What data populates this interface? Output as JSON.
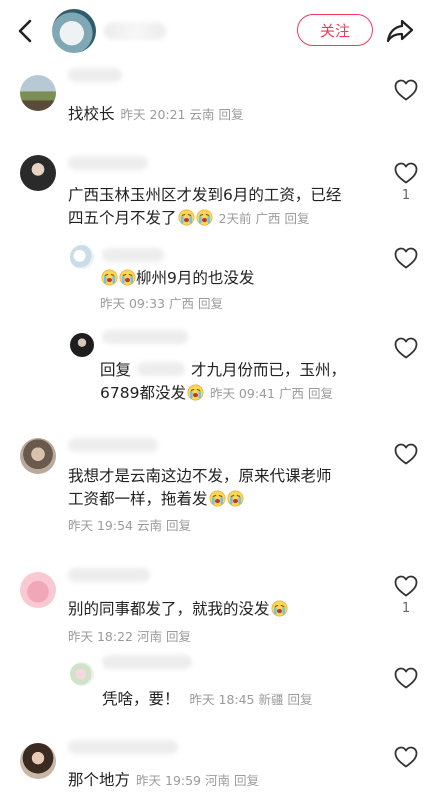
{
  "header": {
    "follow_label": "关注",
    "icons": [
      "back-arrow-icon",
      "share-icon"
    ]
  },
  "comments": [
    {
      "text": "找校长",
      "time": "昨天 20:21",
      "region": "云南",
      "reply": "回复"
    },
    {
      "text_line1": "广西玉林玉州区才发到6月的工资，已经",
      "text_line2": "四五个月不发了",
      "time": "2天前",
      "region": "广西",
      "reply": "回复",
      "likes": "1",
      "replies": [
        {
          "text": "柳州9月的也没发",
          "time": "昨天 09:33",
          "region": "广西",
          "reply": "回复"
        },
        {
          "prefix": "回复",
          "text_line1": "才九月份而已，玉州，",
          "text_line2": "6789都没发",
          "time": "昨天 09:41",
          "region": "广西",
          "reply": "回复"
        }
      ]
    },
    {
      "text_line1": "我想才是云南这边不发，原来代课老师",
      "text_line2": "工资都一样，拖着发",
      "time": "昨天 19:54",
      "region": "云南",
      "reply": "回复"
    },
    {
      "text": "别的同事都发了，就我的没发",
      "time": "昨天 18:22",
      "region": "河南",
      "reply": "回复",
      "likes": "1",
      "replies": [
        {
          "text": "凭啥，要！",
          "time": "昨天 18:45",
          "region": "新疆",
          "reply": "回复"
        }
      ]
    },
    {
      "text": "那个地方",
      "time": "昨天 19:59",
      "region": "河南",
      "reply": "回复"
    }
  ],
  "colors": {
    "accent": "#f03c5a",
    "meta": "#9b9b9b"
  }
}
